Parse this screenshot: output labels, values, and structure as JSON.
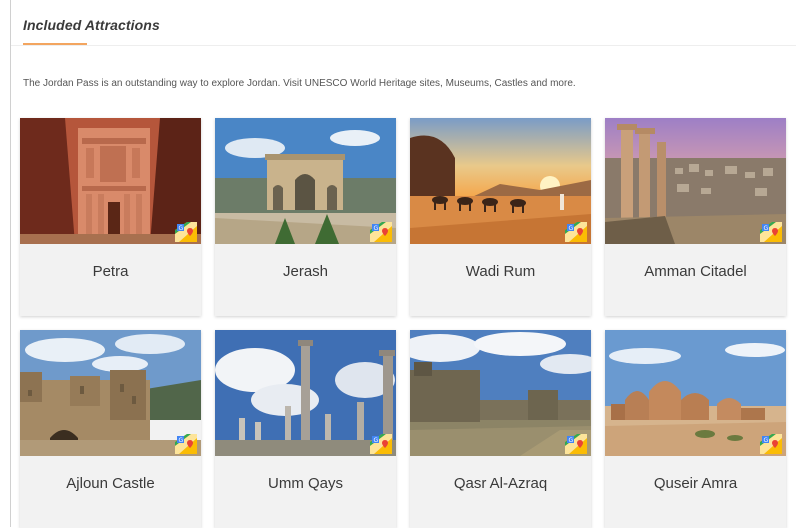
{
  "section": {
    "title": "Included Attractions",
    "intro": "The Jordan Pass is an outstanding way to explore Jordan. Visit UNESCO World Heritage sites, Museums, Castles and more."
  },
  "accent_color": "#f3a55f",
  "attractions": [
    {
      "name": "Petra",
      "icon": "google-maps-icon"
    },
    {
      "name": "Jerash",
      "icon": "google-maps-icon"
    },
    {
      "name": "Wadi Rum",
      "icon": "google-maps-icon"
    },
    {
      "name": "Amman Citadel",
      "icon": "google-maps-icon"
    },
    {
      "name": "Ajloun Castle",
      "icon": "google-maps-icon"
    },
    {
      "name": "Umm Qays",
      "icon": "google-maps-icon"
    },
    {
      "name": "Qasr Al-Azraq",
      "icon": "google-maps-icon"
    },
    {
      "name": "Quseir Amra",
      "icon": "google-maps-icon"
    }
  ]
}
